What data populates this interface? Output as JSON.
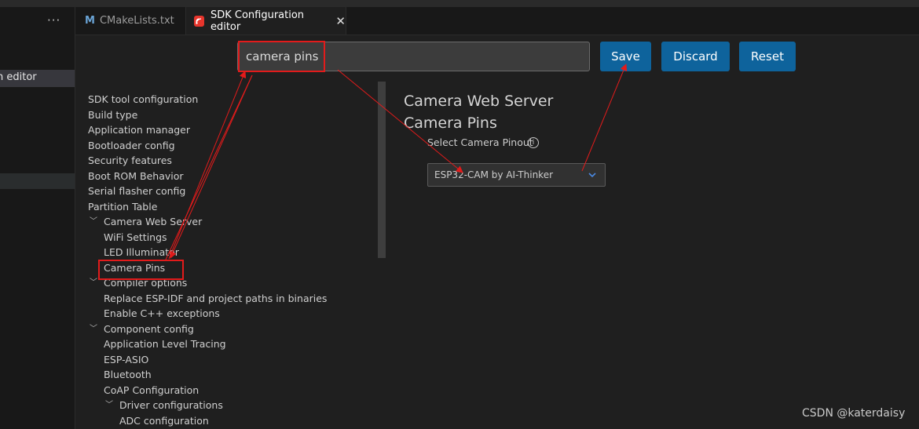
{
  "left_panel": {
    "menu_icon": "more-horizontal-icon",
    "active_label": "n editor"
  },
  "tabs": [
    {
      "label": "CMakeLists.txt",
      "icon": "cmake-m-icon"
    },
    {
      "label": "SDK Configuration editor",
      "icon": "esp-idf-icon",
      "close_symbol": "✕"
    }
  ],
  "search": {
    "value": "camera pins"
  },
  "toolbar": {
    "save_label": "Save",
    "discard_label": "Discard",
    "reset_label": "Reset"
  },
  "menu_tree": [
    "SDK tool configuration",
    "Build type",
    "Application manager",
    "Bootloader config",
    "Security features",
    "Boot ROM Behavior",
    "Serial flasher config",
    "Partition Table",
    "Camera Web Server",
    "WiFi Settings",
    "LED Illuminator",
    "Camera Pins",
    "Compiler options",
    "Replace ESP-IDF and project paths in binaries",
    "Enable C++ exceptions",
    "Component config",
    "Application Level Tracing",
    "ESP-ASIO",
    "Bluetooth",
    "CoAP Configuration",
    "Driver configurations",
    "ADC configuration"
  ],
  "content": {
    "section_title": "Camera Web Server",
    "subsection_title": "Camera Pins",
    "pinout_label": "Select Camera Pinout",
    "info_symbol": "i",
    "pinout_selected": "ESP32-CAM by AI-Thinker"
  },
  "annotation_color": "#e21b1b",
  "accent_color": "#0e639c",
  "watermark": "CSDN @katerdaisy"
}
